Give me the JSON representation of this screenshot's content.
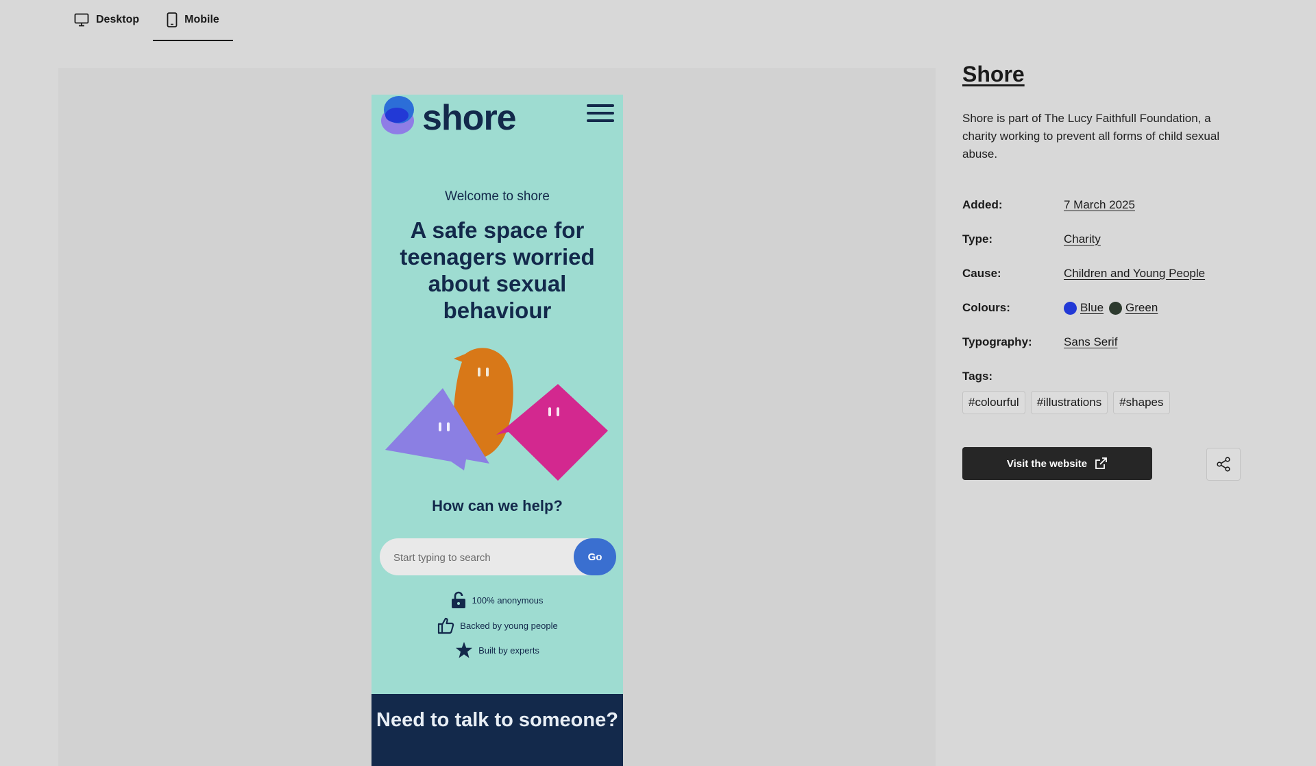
{
  "view_toggle": {
    "desktop_label": "Desktop",
    "mobile_label": "Mobile",
    "active": "Mobile"
  },
  "preview": {
    "logo_text": "shore",
    "welcome": "Welcome to shore",
    "headline": "A safe space for teenagers worried about sexual behaviour",
    "help_title": "How can we help?",
    "search_placeholder": "Start typing to search",
    "go_label": "Go",
    "features": [
      {
        "icon": "padlock-icon",
        "text": "100% anonymous"
      },
      {
        "icon": "thumbs-up-icon",
        "text": "Backed by young people"
      },
      {
        "icon": "star-icon",
        "text": "Built by experts"
      }
    ],
    "footer_title": "Need to talk to someone?",
    "colors": {
      "background": "#9edcd1",
      "navy": "#13294b",
      "go_button": "#3a6fd0"
    }
  },
  "details": {
    "title": "Shore",
    "description": "Shore is part of The Lucy Faithfull Foundation, a charity working to prevent all forms of child sexual abuse.",
    "added_label": "Added:",
    "added_value": "7 March 2025",
    "type_label": "Type:",
    "type_value": "Charity",
    "cause_label": "Cause:",
    "cause_value": "Children and Young People",
    "colours_label": "Colours:",
    "colours": [
      {
        "name": "Blue",
        "hex": "#2239d6"
      },
      {
        "name": "Green",
        "hex": "#2d3a2e"
      }
    ],
    "typography_label": "Typography:",
    "typography_value": "Sans Serif",
    "tags_label": "Tags:",
    "tags": [
      "#colourful",
      "#illustrations",
      "#shapes"
    ],
    "visit_label": "Visit the website"
  }
}
